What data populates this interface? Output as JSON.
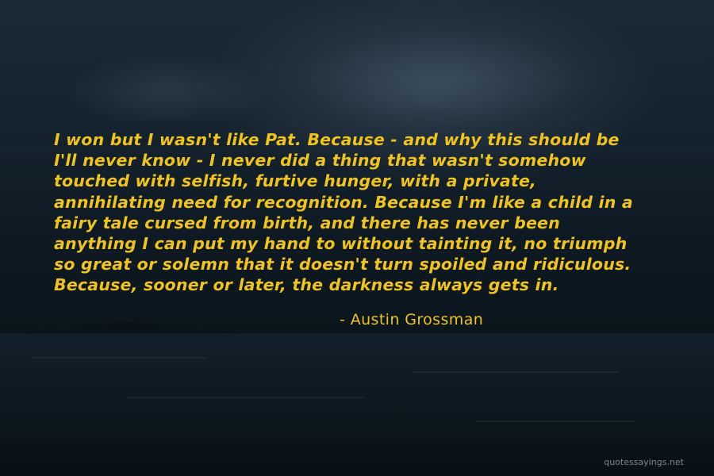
{
  "quote": {
    "lines": [
      "I won but I wasn't like Pat. Because - and why this should be",
      "I'll never know - I never did a thing that wasn't somehow",
      "touched with selfish, furtive hunger, with a private,",
      "annihilating need for recognition. Because I'm like a child in a",
      "fairy tale cursed from birth, and there has never been",
      "anything I can put my hand to without tainting it, no triumph",
      "so great or solemn that it doesn't turn spoiled and ridiculous.",
      "Because, sooner or later, the darkness always gets in."
    ],
    "author": "- Austin Grossman",
    "text_color": "#f0c41d"
  },
  "watermark": "quotessayings.net",
  "background": {
    "description_colors": [
      "#1b2a36",
      "#0a141b"
    ]
  }
}
